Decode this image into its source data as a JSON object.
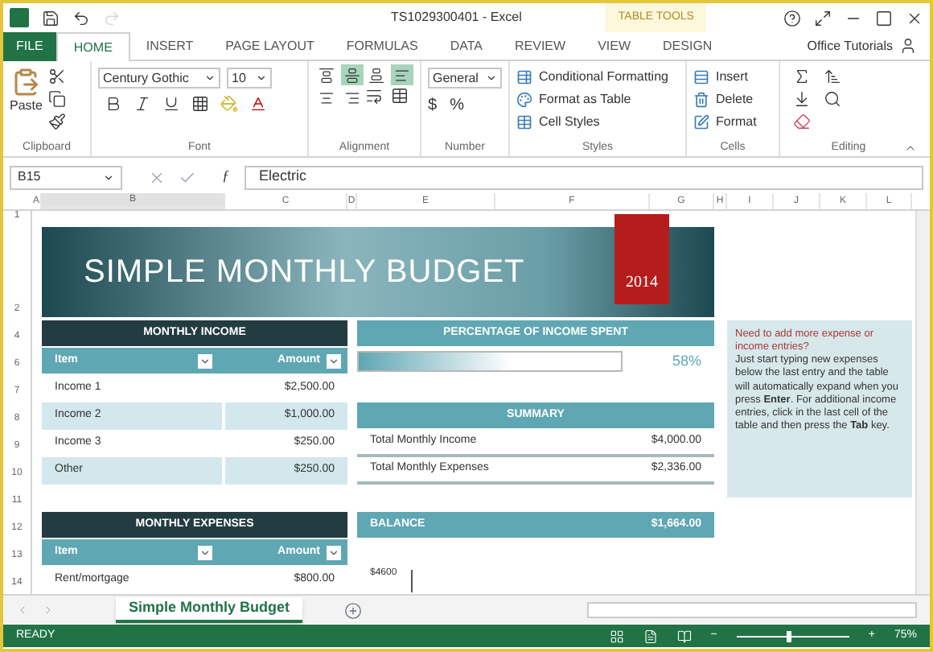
{
  "window": {
    "title": "TS1029300401 - Excel",
    "context_tab": "TABLE TOOLS",
    "account": "Office Tutorials"
  },
  "file_tab": "FILE",
  "ribbon_tabs": [
    {
      "label": "HOME",
      "selected": true
    },
    {
      "label": "INSERT",
      "selected": false
    },
    {
      "label": "PAGE LAYOUT",
      "selected": false
    },
    {
      "label": "FORMULAS",
      "selected": false
    },
    {
      "label": "DATA",
      "selected": false
    },
    {
      "label": "REVIEW",
      "selected": false
    },
    {
      "label": "VIEW",
      "selected": false
    },
    {
      "label": "DESIGN",
      "selected": false
    }
  ],
  "ribbon": {
    "clipboard": {
      "label": "Clipboard",
      "paste": "Paste"
    },
    "font": {
      "label": "Font",
      "font": "Century Gothic",
      "size": "10"
    },
    "alignment": {
      "label": "Alignment",
      "buttons": [
        {
          "kind": "top",
          "selected": false
        },
        {
          "kind": "middle",
          "selected": true
        },
        {
          "kind": "bottom",
          "selected": false
        },
        {
          "kind": "left",
          "selected": true
        },
        {
          "kind": "center",
          "selected": false
        },
        {
          "kind": "right",
          "selected": false
        }
      ]
    },
    "number": {
      "label": "Number",
      "format": "General",
      "currency": "$",
      "percent": "%"
    },
    "styles": {
      "label": "Styles",
      "items": [
        "Conditional Formatting",
        "Format as Table",
        "Cell Styles"
      ]
    },
    "cells": {
      "label": "Cells",
      "items": [
        "Insert",
        "Delete",
        "Format"
      ]
    },
    "editing": {
      "label": "Editing"
    }
  },
  "formula_bar": {
    "name_box": "B15",
    "function_symbol": "ƒ",
    "value": "Electric"
  },
  "columns": [
    "A",
    "B",
    "C",
    "D",
    "E",
    "F",
    "G",
    "H",
    "I",
    "J",
    "K",
    "L"
  ],
  "row_numbers": [
    "1",
    "2",
    "4",
    "6",
    "7",
    "8",
    "9",
    "10",
    "11",
    "12",
    "13",
    "14"
  ],
  "budget": {
    "title": "SIMPLE MONTHLY BUDGET",
    "year": "2014",
    "income": {
      "header": "MONTHLY INCOME",
      "columns": [
        "Item",
        "Amount"
      ],
      "rows": [
        {
          "item": "Income 1",
          "amount": "$2,500.00"
        },
        {
          "item": "Income 2",
          "amount": "$1,000.00"
        },
        {
          "item": "Income 3",
          "amount": "$250.00"
        },
        {
          "item": "Other",
          "amount": "$250.00"
        }
      ]
    },
    "percentage": {
      "header": "PERCENTAGE OF INCOME SPENT",
      "level": 0.58,
      "reading": "58%"
    },
    "summary": {
      "header": "SUMMARY",
      "rows": [
        {
          "label": "Total Monthly Income",
          "value": "$4,000.00"
        },
        {
          "label": "Total Monthly Expenses",
          "value": "$2,336.00"
        }
      ]
    },
    "balance": {
      "label": "BALANCE",
      "value": "$1,664.00"
    },
    "expenses": {
      "header": "MONTHLY EXPENSES",
      "columns": [
        "Item",
        "Amount"
      ],
      "rows": [
        {
          "item": "Rent/mortgage",
          "amount": "$800.00"
        }
      ]
    },
    "chart_label": "$4600",
    "note": {
      "title": "Need to add more expense or income entries?",
      "body": "Just start typing new expenses below the last entry and the table will automatically expand when you press **Enter**. For additional income entries, click in the last cell of the table and then press the **Tab** key."
    }
  },
  "sheet_tabs": [
    {
      "label": "Simple Monthly Budget",
      "selected": true
    }
  ],
  "status_bar": {
    "status": "READY",
    "zoom_out": "−",
    "zoom_in": "+",
    "zoom": "75%",
    "zoom_slider": {
      "level": 0.45
    }
  }
}
